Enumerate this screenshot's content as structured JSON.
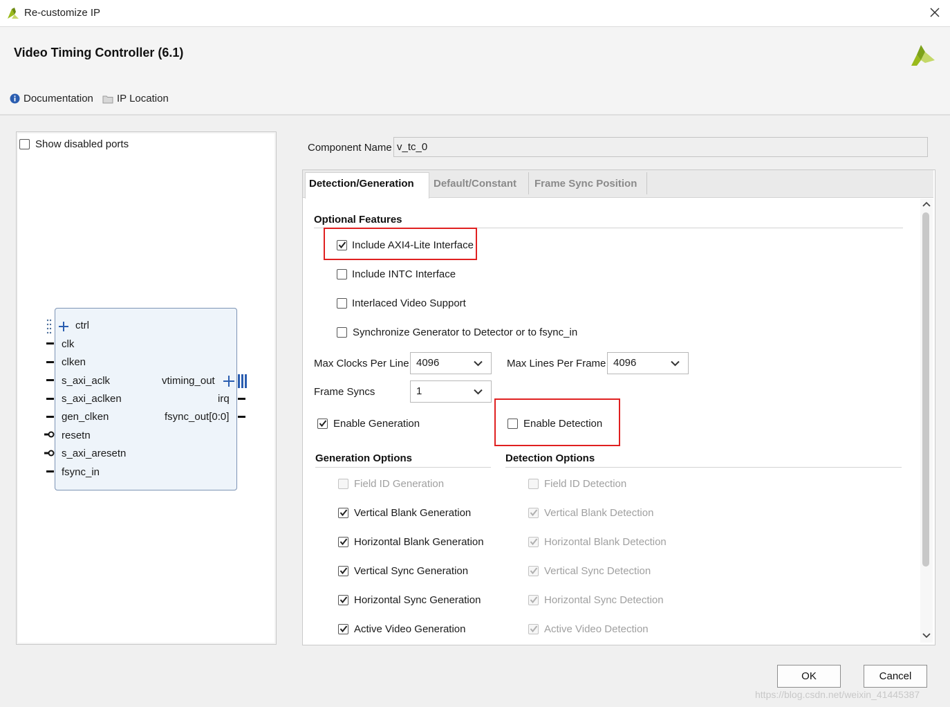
{
  "window": {
    "title": "Re-customize IP"
  },
  "header": {
    "ip_name": "Video Timing Controller (6.1)",
    "documentation": "Documentation",
    "ip_location": "IP Location"
  },
  "left_panel": {
    "show_disabled_ports": "Show disabled ports",
    "show_disabled_ports_checked": false,
    "ports_left": [
      "ctrl",
      "clk",
      "clken",
      "s_axi_aclk",
      "s_axi_aclken",
      "gen_clken",
      "resetn",
      "s_axi_aresetn",
      "fsync_in"
    ],
    "ports_right": [
      "vtiming_out",
      "irq",
      "fsync_out[0:0]"
    ]
  },
  "component": {
    "label": "Component Name",
    "value": "v_tc_0"
  },
  "tabs": [
    "Detection/Generation",
    "Default/Constant",
    "Frame Sync Position"
  ],
  "optional_features": {
    "title": "Optional Features",
    "items": [
      {
        "label": "Include AXI4-Lite Interface",
        "checked": true
      },
      {
        "label": "Include INTC Interface",
        "checked": false
      },
      {
        "label": "Interlaced Video Support",
        "checked": false
      },
      {
        "label": "Synchronize Generator to Detector or to fsync_in",
        "checked": false
      }
    ]
  },
  "settings": {
    "max_clocks_label": "Max Clocks Per Line",
    "max_clocks_value": "4096",
    "max_lines_label": "Max Lines Per Frame",
    "max_lines_value": "4096",
    "frame_syncs_label": "Frame Syncs",
    "frame_syncs_value": "1",
    "enable_generation": "Enable Generation",
    "enable_generation_checked": true,
    "enable_detection": "Enable Detection",
    "enable_detection_checked": false
  },
  "generation_options": {
    "title": "Generation Options",
    "items": [
      {
        "label": "Field ID Generation",
        "checked": false,
        "disabled": true
      },
      {
        "label": "Vertical Blank Generation",
        "checked": true,
        "disabled": false
      },
      {
        "label": "Horizontal Blank Generation",
        "checked": true,
        "disabled": false
      },
      {
        "label": "Vertical Sync Generation",
        "checked": true,
        "disabled": false
      },
      {
        "label": "Horizontal Sync Generation",
        "checked": true,
        "disabled": false
      },
      {
        "label": "Active Video Generation",
        "checked": true,
        "disabled": false
      }
    ]
  },
  "detection_options": {
    "title": "Detection Options",
    "items": [
      {
        "label": "Field ID Detection",
        "checked": false,
        "disabled": true
      },
      {
        "label": "Vertical Blank Detection",
        "checked": true,
        "disabled": true
      },
      {
        "label": "Horizontal Blank Detection",
        "checked": true,
        "disabled": true
      },
      {
        "label": "Vertical Sync Detection",
        "checked": true,
        "disabled": true
      },
      {
        "label": "Horizontal Sync Detection",
        "checked": true,
        "disabled": true
      },
      {
        "label": "Active Video Detection",
        "checked": true,
        "disabled": true
      }
    ]
  },
  "footer": {
    "ok": "OK",
    "cancel": "Cancel",
    "watermark": "https://blog.csdn.net/weixin_41445387"
  },
  "colors": {
    "highlight": "#e02020",
    "xilinx_logo": "#9aba1c",
    "info_icon": "#2a5db0"
  }
}
